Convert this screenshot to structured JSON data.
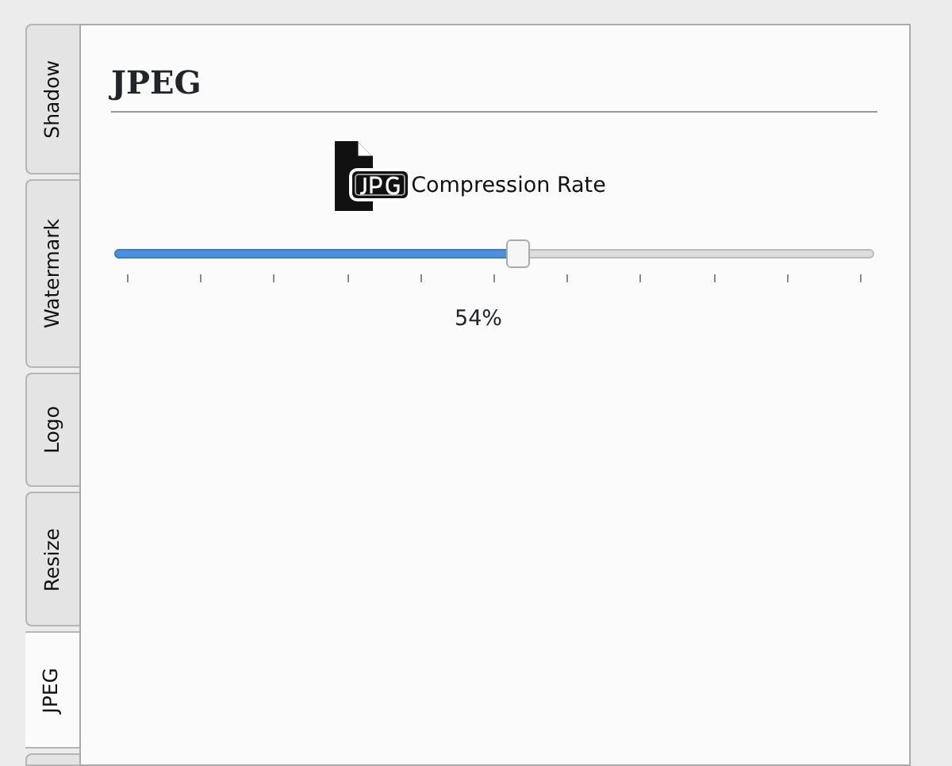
{
  "tabs": [
    {
      "label": "Shadow",
      "selected": false
    },
    {
      "label": "Watermark",
      "selected": false
    },
    {
      "label": "Logo",
      "selected": false
    },
    {
      "label": "Resize",
      "selected": false
    },
    {
      "label": "JPEG",
      "selected": true
    }
  ],
  "panel": {
    "title": "JPEG",
    "compression": {
      "label": "Compression Rate",
      "level": 0.53,
      "reading": "54%"
    }
  }
}
